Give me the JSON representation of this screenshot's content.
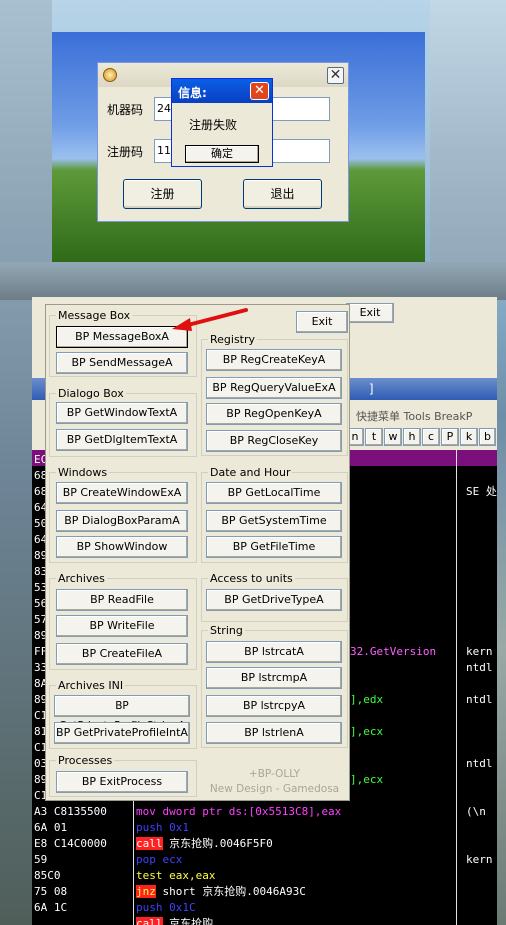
{
  "reg_app": {
    "machine_label": "机器码",
    "machine_value": "248",
    "register_code_label": "注册码",
    "register_code_value": "111",
    "register_button": "注册",
    "exit_button": "退出"
  },
  "message_dialog": {
    "title": "信息:",
    "message": "注册失败",
    "ok_button": "确定"
  },
  "olly_window": {
    "menu_fragment": "快捷菜单  Tools  BreakP",
    "title_fragment": "]",
    "toolbar_letters": [
      "n",
      "t",
      "w",
      "h",
      "c",
      "P",
      "k",
      "b"
    ],
    "exit_behind": "Exit"
  },
  "bp_panel": {
    "exit_button": "Exit",
    "groups": {
      "message_box": "Message Box",
      "dialog_box": "Dialogo Box",
      "windows": "Windows",
      "archives": "Archives",
      "archives_ini": "Archives INI",
      "processes": "Processes",
      "registry": "Registry",
      "date_hour": "Date and Hour",
      "access_units": "Access to units",
      "string": "String"
    },
    "buttons": {
      "messageboxa": "BP  MessageBoxA",
      "sendmessagea": "BP SendMessageA",
      "getwindowtexta": "BP GetWindowTextA",
      "getdlgitemtexta": "BP GetDlgItemTextA",
      "createwindowexa": "BP CreateWindowExA",
      "dialogboxparama": "BP DialogBoxParamA",
      "showwindow": "BP ShowWindow",
      "readfile": "BP ReadFile",
      "writefile": "BP WriteFile",
      "createfilea": "BP CreateFileA",
      "getprivateprofilestringa": "BP GetPrivateProfileStringA",
      "getprivateprofileinta": "BP GetPrivateProfileIntA",
      "exitprocess": "BP ExitProcess",
      "regcreatekeya": "BP RegCreateKeyA",
      "regqueryvalueexa": "BP RegQueryValueExA",
      "regopenkeya": "BP RegOpenKeyA",
      "regclosekey": "BP RegCloseKey",
      "getlocaltime": "BP GetLocalTime",
      "getsystemtime": "BP GetSystemTime",
      "getfiletime": "BP GetFileTime",
      "getdrivetypea": "BP GetDriveTypeA",
      "lstrcata": "BP lstrcatA",
      "lstrcmpa": "BP lstrcmpA",
      "lstrcpya": "BP lstrcpyA",
      "lstrlena": "BP lstrlenA"
    },
    "credit_1": "+BP-OLLY",
    "credit_2": "New Design - Gamedosa"
  },
  "disasm": {
    "left_col": [
      "EC",
      "68",
      "68",
      "64",
      "50",
      "64",
      "89",
      "83",
      "53",
      "56",
      "57",
      "89",
      "FF",
      "33",
      "8A",
      "89",
      "C1",
      "81",
      "C1",
      "03",
      "89",
      "C1",
      "A3 C8135500",
      "6A 01",
      "E8 C14C0000",
      "59",
      "85C0",
      "75 08",
      "6A 1C"
    ],
    "mid_fragments": [
      {
        "text": "32.GetVersion",
        "row": 12
      },
      {
        "text": "],edx",
        "row": 15
      },
      {
        "text": "],ecx",
        "row": 17
      },
      {
        "text": "],ecx",
        "row": 20
      }
    ],
    "bottom_code": [
      {
        "op": "mov",
        "args": "dword ptr ds:[0x5513C8],eax",
        "kind": "mov"
      },
      {
        "op": "push",
        "args": "0x1",
        "kind": "push"
      },
      {
        "op": "call",
        "args": "京东抢购.0046F5F0",
        "kind": "call"
      },
      {
        "op": "pop",
        "args": "ecx",
        "kind": "pop"
      },
      {
        "op": "test",
        "args": "eax,eax",
        "kind": "test"
      },
      {
        "op": "jnz",
        "args": "short 京东抢购.0046A93C",
        "kind": "jnz"
      },
      {
        "op": "push",
        "args": "0x1C",
        "kind": "push"
      },
      {
        "op": "call",
        "args": "京东抢购",
        "kind": "call"
      }
    ],
    "right_col": [
      {
        "text": "SE 处",
        "row": 2
      },
      {
        "text": "kern",
        "row": 12
      },
      {
        "text": "ntdl",
        "row": 13
      },
      {
        "text": "ntdl",
        "row": 15
      },
      {
        "text": "ntdl",
        "row": 19
      },
      {
        "text": "(\\n",
        "row": 22
      },
      {
        "text": "kern",
        "row": 25
      }
    ]
  },
  "colors": {
    "xp_blue": "#0a246a",
    "dialog_face": "#ece9d8",
    "disasm_bg": "#000000",
    "purple_bar": "#7b0f7b",
    "mov_color": "#ff40ff",
    "push_color": "#4040ff",
    "call_bg": "#ff2020",
    "jnz_bg": "#ff2020",
    "test_color": "#ffff40"
  }
}
